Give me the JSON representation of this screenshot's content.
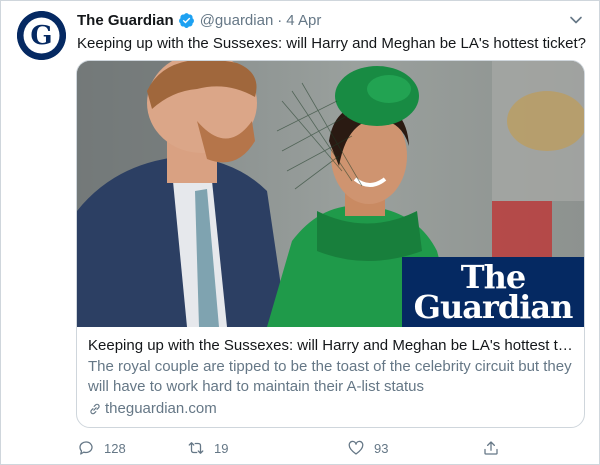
{
  "account": {
    "name": "The Guardian",
    "handle": "@guardian",
    "separator": "·",
    "date": "4 Apr",
    "avatar_letter": "G",
    "verified_icon": "verified-badge-icon",
    "brand_color": "#052962"
  },
  "tweet": {
    "text": "Keeping up with the Sussexes: will Harry and Meghan be LA's hottest ticket?"
  },
  "card": {
    "logo_line1": "The",
    "logo_line2": "Guardian",
    "title": "Keeping up with the Sussexes: will Harry and Meghan be LA's hottest tic…",
    "description": "The royal couple are tipped to be the toast of the celebrity circuit but they will have to work hard to maintain their A-list status",
    "domain": "theguardian.com"
  },
  "actions": {
    "replies": "128",
    "retweets": "19",
    "likes": "93"
  },
  "colors": {
    "text": "#14171a",
    "secondary": "#657786",
    "verified": "#1da1f2",
    "border": "#cfd6dc"
  }
}
